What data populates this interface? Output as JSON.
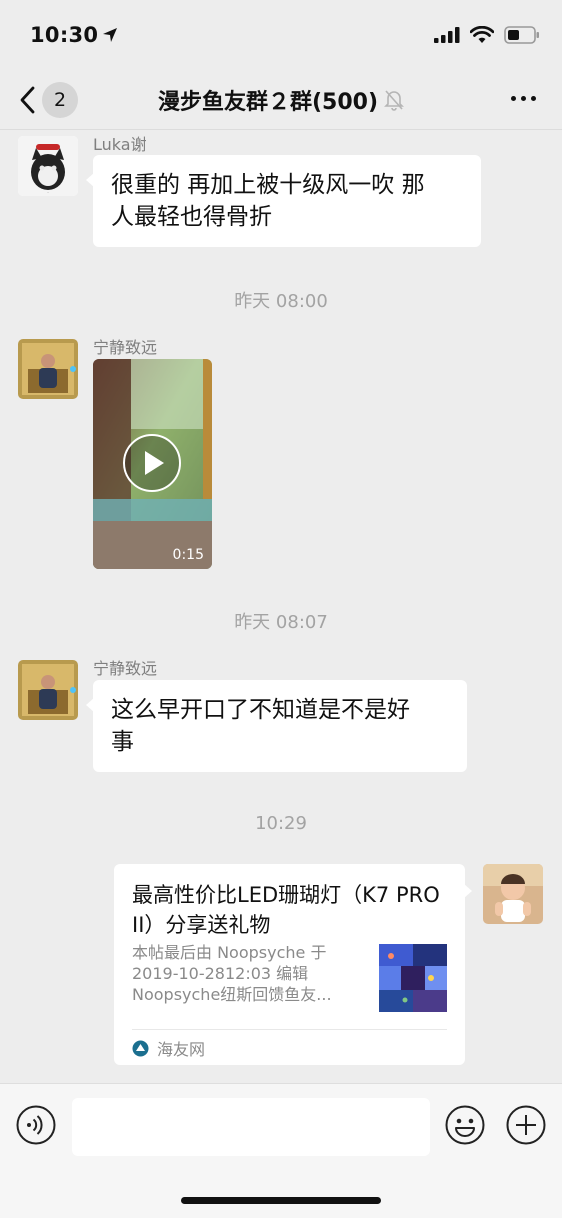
{
  "status_bar": {
    "time": "10:30",
    "icons": [
      "location-arrow-icon",
      "signal-icon",
      "wifi-icon",
      "battery-icon"
    ]
  },
  "nav": {
    "back_count": "2",
    "title": "漫步鱼友群２群(500)",
    "muted_icon": "bell-muted-icon",
    "more_icon": "more-dots-icon"
  },
  "messages": [
    {
      "sender": "Luka谢",
      "text_line1": "很重的 再加上被十级风一吹 那",
      "text_line2": "人最轻也得骨折"
    },
    {
      "timestamp": "昨天 08:00"
    },
    {
      "sender": "宁静致远",
      "video_duration": "0:15"
    },
    {
      "timestamp": "昨天 08:07"
    },
    {
      "sender": "宁静致远",
      "text_line1": "这么早开口了不知道是不是好",
      "text_line2": "事"
    },
    {
      "timestamp": "10:29"
    },
    {
      "link_card": {
        "title": "最高性价比LED珊瑚灯（K7 PRO II）分享送礼物",
        "desc_line1": "本帖最后由 Noopsyche 于",
        "desc_line2": "2019-10-2812:03 编辑",
        "desc_line3": "Noopsyche纽斯回馈鱼友...",
        "source": "海友网"
      }
    }
  ],
  "input_bar": {
    "voice_icon": "voice-icon",
    "emoji_icon": "emoji-icon",
    "plus_icon": "plus-icon",
    "placeholder": ""
  }
}
